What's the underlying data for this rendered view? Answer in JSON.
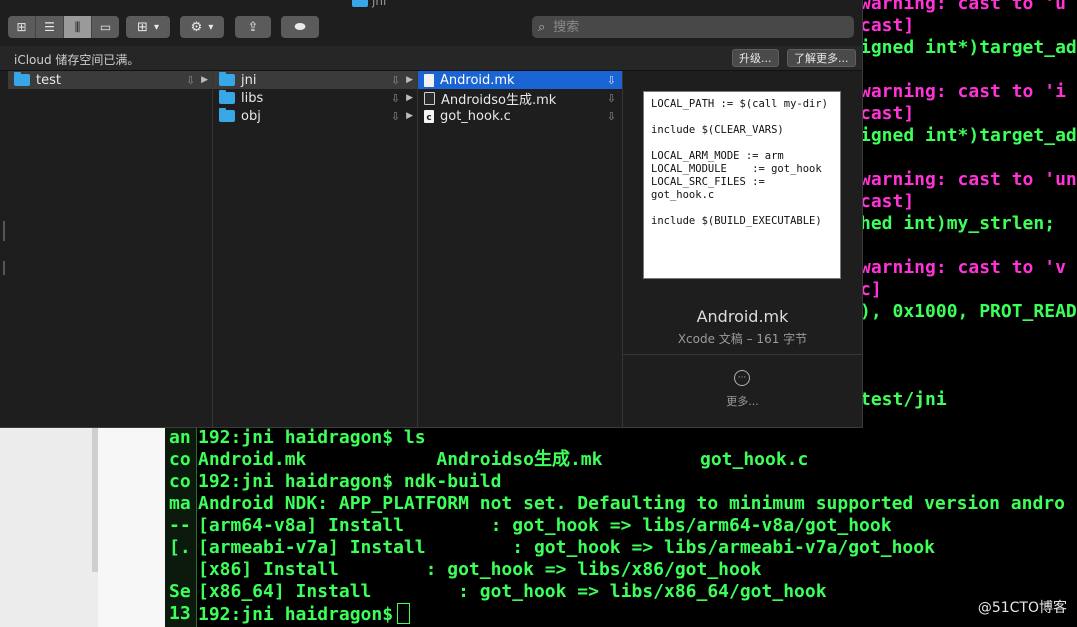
{
  "finder": {
    "window_title": "jni",
    "toolbar": {
      "view_icons": [
        "⊞",
        "☰",
        "⫼",
        "▭"
      ],
      "group_icon": "⊞",
      "action_icon": "⚙",
      "share_icon": "⇪",
      "tag_icon": "⬬",
      "chevron": "▾",
      "search_icon": "⌕",
      "search_placeholder": "搜索"
    },
    "icloud_bar": {
      "message": "iCloud 储存空间已满。",
      "upgrade_label": "升级...",
      "learn_more_label": "了解更多..."
    },
    "column1": [
      {
        "name": "test"
      }
    ],
    "column2": [
      {
        "name": "jni"
      },
      {
        "name": "libs"
      },
      {
        "name": "obj"
      }
    ],
    "column3": [
      {
        "name": "Android.mk"
      },
      {
        "name": "Androidso生成.mk"
      },
      {
        "name": "got_hook.c"
      }
    ],
    "icons": {
      "cloud": "⇩",
      "chevron_right": "▶",
      "c_file": "c"
    },
    "preview": {
      "content": "LOCAL_PATH := $(call my-dir)\n\ninclude $(CLEAR_VARS)\n\nLOCAL_ARM_MODE := arm\nLOCAL_MODULE    := got_hook\nLOCAL_SRC_FILES := got_hook.c\n\ninclude $(BUILD_EXECUTABLE)",
      "file_name": "Android.mk",
      "file_info": "Xcode 文稿 – 161 字节",
      "more_icon": "···",
      "more_label": "更多..."
    }
  },
  "terminal_right": {
    "lines": [
      {
        "text": "warning: cast to 'u",
        "color": "magenta"
      },
      {
        "text": "cast]",
        "color": "magenta"
      },
      {
        "text": "igned int*)target_ad",
        "color": "green"
      },
      {
        "text": "",
        "color": "green"
      },
      {
        "text": "warning: cast to 'i",
        "color": "magenta"
      },
      {
        "text": "cast]",
        "color": "magenta"
      },
      {
        "text": "igned int*)target_ad",
        "color": "green"
      },
      {
        "text": "",
        "color": "green"
      },
      {
        "text": "warning: cast to 'un",
        "color": "magenta"
      },
      {
        "text": "cast]",
        "color": "magenta"
      },
      {
        "text": "hed int)my_strlen;",
        "color": "green"
      },
      {
        "text": "",
        "color": "green"
      },
      {
        "text": "warning: cast to 'v",
        "color": "magenta"
      },
      {
        "text": "c]",
        "color": "magenta"
      },
      {
        "text": "), 0x1000, PROT_READ",
        "color": "green"
      },
      {
        "text": "",
        "color": "green"
      },
      {
        "text": "",
        "color": "green"
      },
      {
        "text": "",
        "color": "green"
      },
      {
        "text": "test/jni",
        "color": "green"
      }
    ]
  },
  "terminal_bottom": {
    "gutter": [
      "an",
      "co",
      "co",
      "ma",
      "--",
      "[.",
      "",
      "Se",
      "13"
    ],
    "lines": [
      "192:jni haidragon$ ls",
      "Android.mk            Androidso生成.mk         got_hook.c",
      "192:jni haidragon$ ndk-build",
      "Android NDK: APP_PLATFORM not set. Defaulting to minimum supported version andro",
      "[arm64-v8a] Install        : got_hook => libs/arm64-v8a/got_hook",
      "[armeabi-v7a] Install        : got_hook => libs/armeabi-v7a/got_hook",
      "[x86] Install        : got_hook => libs/x86/got_hook",
      "[x86_64] Install        : got_hook => libs/x86_64/got_hook",
      "192:jni haidragon$"
    ]
  },
  "watermark": "@51CTO博客",
  "colors": {
    "selection": "#1a64d3",
    "terminal_green": "#3dff5a",
    "terminal_magenta": "#ff33d6",
    "folder": "#37a7e8"
  }
}
